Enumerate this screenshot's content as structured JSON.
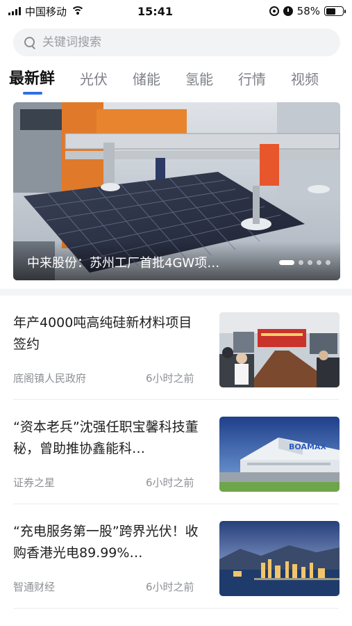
{
  "status_bar": {
    "carrier": "中国移动",
    "time": "15:41",
    "battery": "58%",
    "battery_level": 0.58
  },
  "search": {
    "placeholder": "关键词搜索"
  },
  "tabs": [
    {
      "label": "最新鲜",
      "active": true
    },
    {
      "label": "光伏"
    },
    {
      "label": "储能"
    },
    {
      "label": "氢能"
    },
    {
      "label": "行情"
    },
    {
      "label": "视频"
    }
  ],
  "banner": {
    "title": "中来股份：苏州工厂首批4GW项…",
    "pages": 5,
    "current_page": 1
  },
  "news": [
    {
      "title": "年产4000吨高纯硅新材料项目签约",
      "source": "底阁镇人民政府",
      "time": "6小时之前",
      "thumb": "meeting-photo"
    },
    {
      "title": "“资本老兵”沈强任职宝馨科技董秘，曾助推协鑫能科…",
      "source": "证券之星",
      "time": "6小时之前",
      "thumb": "factory-building-photo",
      "thumb_sign": "BOAMAX"
    },
    {
      "title": "“充电服务第一股”跨界光伏！收购香港光电89.99%…",
      "source": "智通财经",
      "time": "6小时之前",
      "thumb": "city-skyline-photo"
    }
  ],
  "colors": {
    "accent": "#2f6fe8",
    "tab_inactive": "#7d8087",
    "meta_text": "#8d8f94"
  }
}
